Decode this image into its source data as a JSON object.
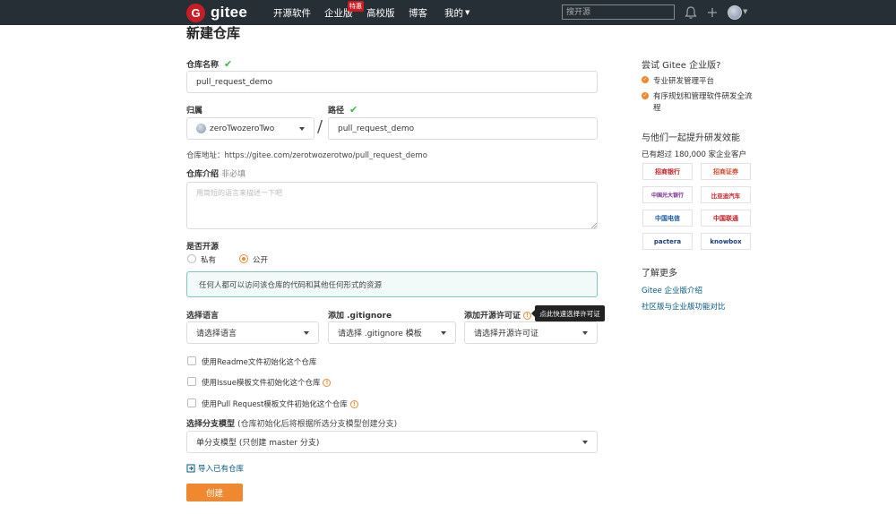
{
  "header": {
    "logo_letter": "G",
    "logo_text": "gitee",
    "nav": [
      {
        "label": "开源软件"
      },
      {
        "label": "企业版"
      },
      {
        "label": "高校版"
      },
      {
        "label": "博客"
      },
      {
        "label": "我的"
      }
    ],
    "hot_badge": "特惠",
    "search_placeholder": "搜开源",
    "colors": {
      "bar": "#262e36",
      "brand": "#c71d23"
    }
  },
  "form": {
    "title": "新建仓库",
    "repo_name": {
      "label": "仓库名称",
      "value": "pull_request_demo"
    },
    "owner": {
      "label": "归属",
      "value": "zeroTwozeroTwo"
    },
    "separator": "/",
    "path": {
      "label": "路径",
      "value": "pull_request_demo"
    },
    "address": "仓库地址：https://gitee.com/zerotwozerotwo/pull_request_demo",
    "intro": {
      "label": "仓库介绍",
      "optional": "非必填",
      "placeholder": "用简短的语言来描述一下吧"
    },
    "open_source": {
      "label": "是否开源",
      "options": [
        {
          "label": "私有",
          "selected": false
        },
        {
          "label": "公开",
          "selected": true
        }
      ],
      "info": "任何人都可以访问该仓库的代码和其他任何形式的资源"
    },
    "language": {
      "label": "选择语言",
      "value": "请选择语言"
    },
    "gitignore": {
      "label": "添加 .gitignore",
      "value": "请选择 .gitignore 模板"
    },
    "license": {
      "label": "添加开源许可证",
      "value": "请选择开源许可证",
      "tooltip": "点此快速选择许可证"
    },
    "init_options": [
      {
        "label": "使用Readme文件初始化这个仓库",
        "checked": false,
        "info": false
      },
      {
        "label": "使用Issue模板文件初始化这个仓库",
        "checked": false,
        "info": true
      },
      {
        "label": "使用Pull Request模板文件初始化这个仓库",
        "checked": false,
        "info": true
      }
    ],
    "branch_model": {
      "label": "选择分支模型",
      "hint": "(仓库初始化后将根据所选分支模型创建分支)",
      "value": "单分支模型 (只创建 master 分支)"
    },
    "import_link": "导入已有仓库",
    "create_button": "创建",
    "accent": "#f0882f"
  },
  "sidebar": {
    "try_title": "尝试 Gitee 企业版?",
    "features": [
      {
        "text": "专业研发管理平台"
      },
      {
        "text": "有序规划和管理软件研发全流程"
      }
    ],
    "improve_title": "与他们一起提升研发效能",
    "customers": "已有超过 180,000 家企业客户",
    "logos": [
      {
        "name": "招商银行"
      },
      {
        "name": "招商证券"
      },
      {
        "name": "中国光大银行"
      },
      {
        "name": "比亚迪汽车"
      },
      {
        "name": "中国电信"
      },
      {
        "name": "中国联通"
      },
      {
        "name": "pactera"
      },
      {
        "name": "knowbox"
      }
    ],
    "more_title": "了解更多",
    "links": [
      {
        "label": "Gitee 企业版介绍"
      },
      {
        "label": "社区版与企业版功能对比"
      }
    ]
  }
}
